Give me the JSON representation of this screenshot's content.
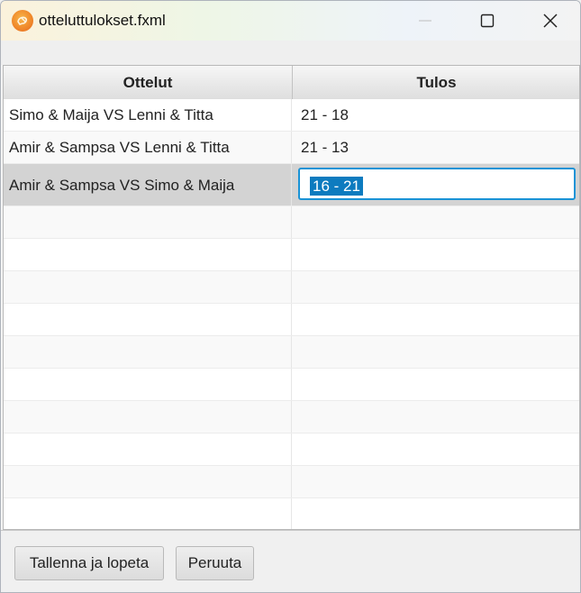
{
  "window": {
    "title": "otteluttulokset.fxml"
  },
  "table": {
    "columns": [
      "Ottelut",
      "Tulos"
    ],
    "rows": [
      {
        "match": "Simo & Maija VS Lenni & Titta",
        "result": "21 - 18"
      },
      {
        "match": "Amir & Sampsa VS Lenni & Titta",
        "result": "21 - 13"
      },
      {
        "match": "Amir & Sampsa VS Simo & Maija",
        "result": "16 - 21",
        "selected": true,
        "editing": true
      }
    ]
  },
  "footer": {
    "save_label": "Tallenna ja lopeta",
    "cancel_label": "Peruuta"
  },
  "icons": {
    "app": "app-icon",
    "minimize": "minimize-icon",
    "maximize": "maximize-icon",
    "close": "close-icon"
  },
  "colors": {
    "selection": "#0d7bbf",
    "focus_border": "#1a93d6",
    "selected_row": "#d3d3d3"
  }
}
